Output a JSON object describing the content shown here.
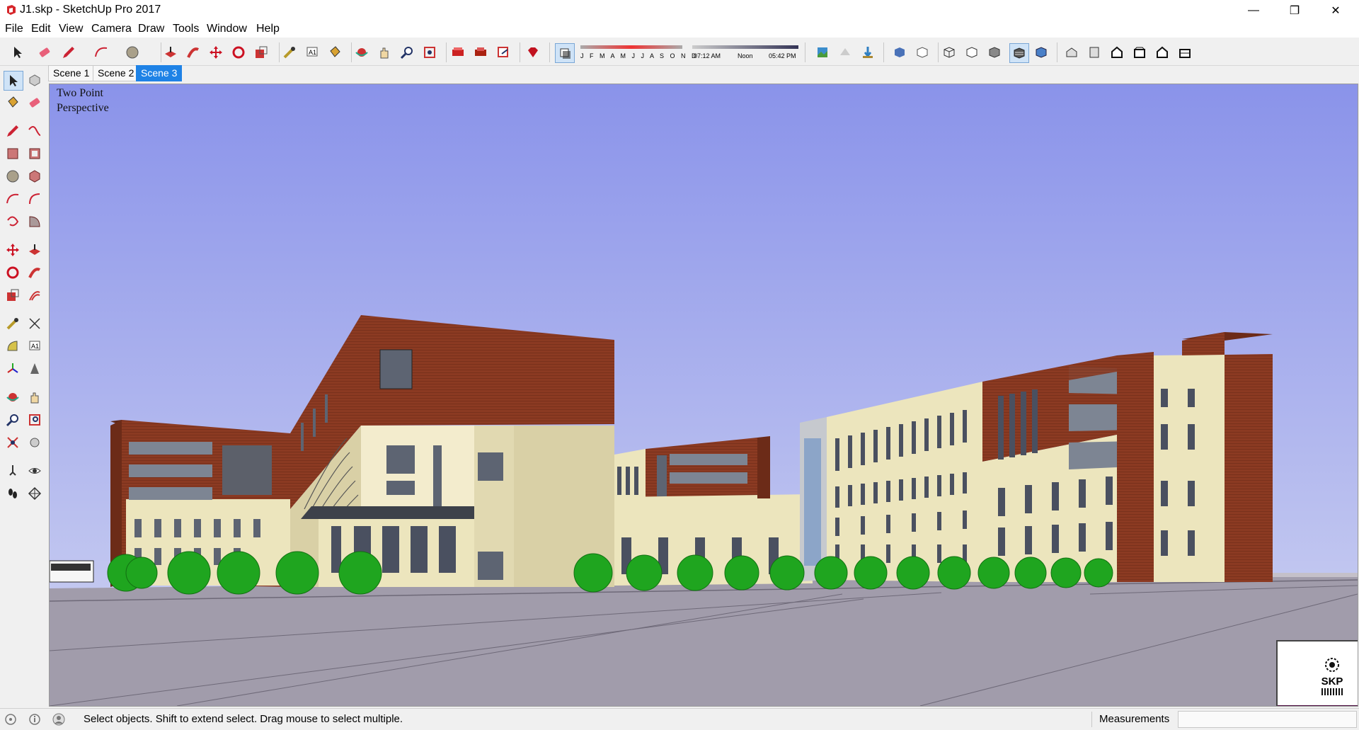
{
  "window": {
    "title": "J1.skp - SketchUp Pro 2017",
    "minimize_glyph": "—",
    "maximize_glyph": "❐",
    "close_glyph": "✕"
  },
  "menu": [
    "File",
    "Edit",
    "View",
    "Camera",
    "Draw",
    "Tools",
    "Window",
    "Help"
  ],
  "shadow_settings": {
    "months": "J F M A M J J A S O N D",
    "time_start": "07:12 AM",
    "time_mid": "Noon",
    "time_end": "05:42 PM"
  },
  "scenes": [
    {
      "label": "Scene 1",
      "active": false
    },
    {
      "label": "Scene 2",
      "active": false
    },
    {
      "label": "Scene 3",
      "active": true
    }
  ],
  "viewport": {
    "camera_line1": "Two Point",
    "camera_line2": "Perspective",
    "thumbnail_text": "SKP"
  },
  "status": {
    "message": "Select objects. Shift to extend select. Drag mouse to select multiple.",
    "measurements_label": "Measurements",
    "measurements_value": ""
  },
  "colors": {
    "sky_top": "#8a93ea",
    "sky_bottom": "#c3c8f0",
    "ground": "#a19cab",
    "brick": "#8b3a22",
    "cream": "#ece5bd",
    "tree": "#1fa51f",
    "scene_active": "#1e82e6"
  },
  "icons": {
    "toolbar": [
      "select-icon",
      "eraser-icon",
      "pencil-icon",
      "arc-icon",
      "shape-icon",
      "push-pull-icon",
      "follow-me-icon",
      "move-icon",
      "rotate-icon",
      "scale-icon",
      "tape-measure-icon",
      "text-icon",
      "paint-bucket-icon",
      "orbit-icon",
      "pan-icon",
      "zoom-icon",
      "zoom-extents-icon",
      "warehouse-icon",
      "extension-warehouse-icon",
      "send-to-layout-icon",
      "ruby-console-icon",
      "shadows-icon",
      "photo-texture-icon",
      "add-location-icon",
      "toggle-terrain-icon",
      "xray-icon",
      "back-edges-icon",
      "wireframe-icon",
      "hidden-line-icon",
      "shaded-icon",
      "shaded-textures-icon",
      "monochrome-icon",
      "iso-view-icon",
      "top-view-icon",
      "front-view-icon",
      "right-view-icon",
      "back-view-icon",
      "left-view-icon"
    ]
  }
}
